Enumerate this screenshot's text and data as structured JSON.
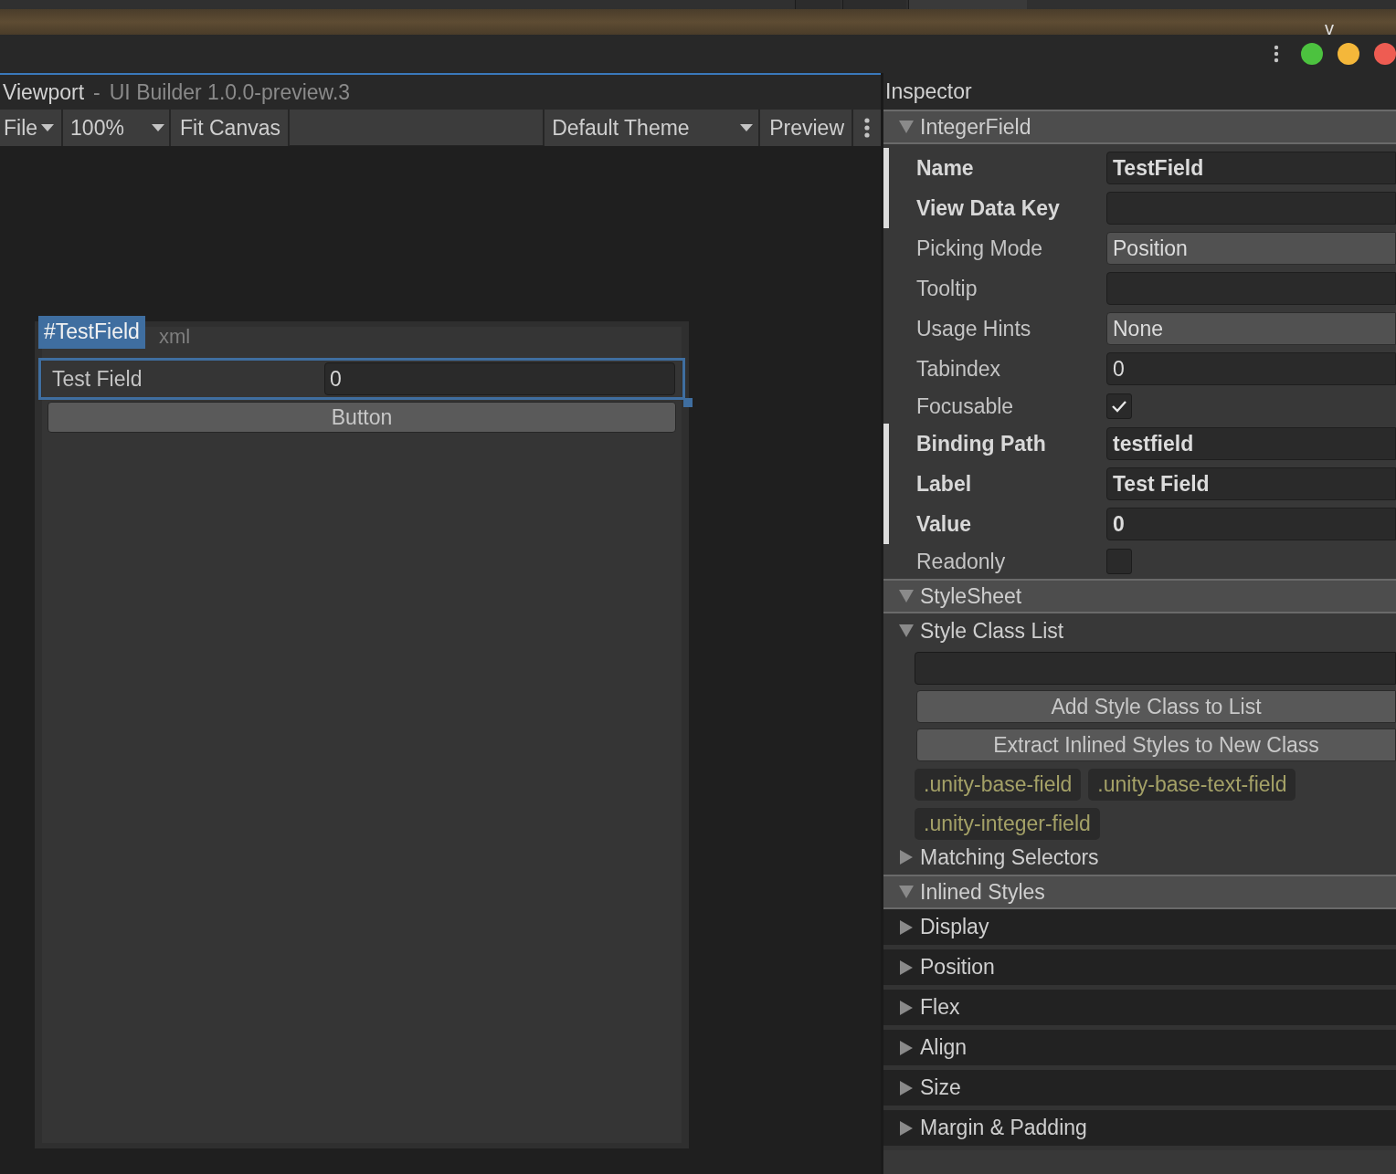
{
  "window_tabs": [
    {
      "selected": false
    },
    {
      "selected": false
    },
    {
      "selected": true
    }
  ],
  "window_top": {
    "cut_text": "v"
  },
  "window_controls": [
    {
      "color": "#4cc23f"
    },
    {
      "color": "#f4b73a"
    },
    {
      "color": "#ee5c52"
    }
  ],
  "viewport": {
    "title": "Viewport",
    "separator": "-",
    "subtitle": "UI Builder 1.0.0-preview.3",
    "toolbar_left": [
      {
        "kind": "menu",
        "label": "File"
      },
      {
        "kind": "dropdown",
        "label": "100%"
      },
      {
        "kind": "button",
        "label": "Fit Canvas"
      }
    ],
    "toolbar_right": [
      {
        "kind": "dropdown",
        "label": "Default Theme"
      },
      {
        "kind": "button",
        "label": "Preview"
      },
      {
        "kind": "more"
      }
    ],
    "canvas": {
      "document_label": "xml",
      "selection_badge": "#TestField",
      "field": {
        "label": "Test Field",
        "value": "0",
        "selected": true
      },
      "button": "Button"
    }
  },
  "inspector": {
    "title": "Inspector",
    "sections": [
      {
        "title": "IntegerField",
        "expanded": true,
        "properties": [
          {
            "kind": "text",
            "label": "Name",
            "value": "TestField",
            "overridden": true
          },
          {
            "kind": "text",
            "label": "View Data Key",
            "overridden": true
          },
          {
            "kind": "dropdown",
            "label": "Picking Mode",
            "value": "Position",
            "overridden": false
          },
          {
            "kind": "text",
            "label": "Tooltip",
            "overridden": false
          },
          {
            "kind": "dropdown",
            "label": "Usage Hints",
            "value": "None",
            "overridden": false
          },
          {
            "kind": "text",
            "label": "Tabindex",
            "value": "0",
            "overridden": false
          },
          {
            "kind": "checkbox",
            "label": "Focusable",
            "checked": true,
            "overridden": false
          },
          {
            "kind": "text",
            "label": "Binding Path",
            "value": "testfield",
            "overridden": true
          },
          {
            "kind": "text",
            "label": "Label",
            "value": "Test Field",
            "overridden": true
          },
          {
            "kind": "text",
            "label": "Value",
            "value": "0",
            "overridden": true
          },
          {
            "kind": "checkbox",
            "label": "Readonly",
            "checked": false,
            "overridden": false
          }
        ]
      },
      {
        "title": "StyleSheet",
        "expanded": true,
        "foldouts": [
          {
            "title": "Style Class List",
            "expanded": true,
            "buttons": [
              "Add Style Class to List",
              "Extract Inlined Styles to New Class"
            ],
            "tags": [
              ".unity-base-field",
              ".unity-base-text-field",
              ".unity-integer-field"
            ]
          },
          {
            "title": "Matching Selectors",
            "expanded": false
          }
        ]
      },
      {
        "title": "Inlined Styles",
        "expanded": true,
        "categories": [
          {
            "title": "Display",
            "expanded": false
          },
          {
            "title": "Position",
            "expanded": false
          },
          {
            "title": "Flex",
            "expanded": false
          },
          {
            "title": "Align",
            "expanded": false
          },
          {
            "title": "Size",
            "expanded": false
          },
          {
            "title": "Margin & Padding",
            "expanded": false
          }
        ]
      }
    ]
  }
}
